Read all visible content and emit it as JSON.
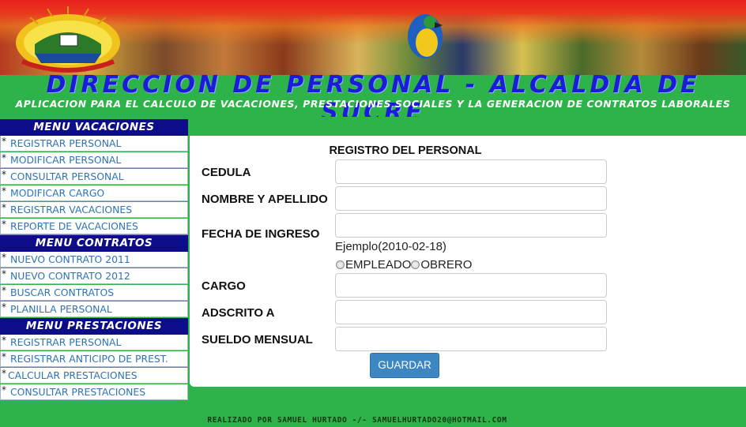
{
  "header": {
    "title": "DIRECCION DE PERSONAL - ALCALDIA DE SUCRE",
    "subtitle": "APLICACION PARA EL CALCULO DE VACACIONES, PRESTACIONES SOCIALES Y LA GENERACION DE CONTRATOS LABORALES"
  },
  "sidebar": {
    "menus": [
      {
        "heading": "MENU VACACIONES",
        "items": [
          {
            "label": "REGISTRAR PERSONAL"
          },
          {
            "label": "MODIFICAR PERSONAL"
          },
          {
            "label": "CONSULTAR PERSONAL"
          },
          {
            "label": "MODIFICAR CARGO"
          },
          {
            "label": "REGISTRAR VACACIONES"
          },
          {
            "label": "REPORTE DE VACACIONES"
          }
        ]
      },
      {
        "heading": "MENU CONTRATOS",
        "items": [
          {
            "label": "NUEVO CONTRATO 2011"
          },
          {
            "label": "NUEVO CONTRATO 2012"
          },
          {
            "label": "BUSCAR CONTRATOS"
          },
          {
            "label": "PLANILLA PERSONAL"
          }
        ]
      },
      {
        "heading": "MENU PRESTACIONES",
        "items": [
          {
            "label": "REGISTRAR PERSONAL"
          },
          {
            "label": "REGISTRAR ANTICIPO DE PREST."
          },
          {
            "label": "CALCULAR PRESTACIONES"
          },
          {
            "label": "CONSULTAR PRESTACIONES"
          }
        ]
      }
    ],
    "bullet": "*"
  },
  "form": {
    "title": "REGISTRO DEL PERSONAL",
    "fields": {
      "cedula": {
        "label": "CEDULA",
        "value": ""
      },
      "nombre": {
        "label": "NOMBRE Y APELLIDO",
        "value": ""
      },
      "fecha": {
        "label": "FECHA DE INGRESO",
        "value": "",
        "hint": "Ejemplo(2010-02-18)"
      },
      "cargo": {
        "label": "CARGO",
        "value": ""
      },
      "adscrito": {
        "label": "ADSCRITO A",
        "value": ""
      },
      "sueldo": {
        "label": "SUELDO MENSUAL",
        "value": ""
      }
    },
    "tipo": {
      "options": [
        "EMPLEADO",
        "OBRERO"
      ],
      "selected": null
    },
    "submit_label": "GUARDAR"
  },
  "footer": {
    "text": "REALIZADO POR SAMUEL HURTADO -/- SAMUELHURTADO20@HOTMAIL.COM"
  },
  "colors": {
    "page_background": "#2db34a",
    "menu_heading": "#0d0d8a",
    "menu_link": "#2f73b5",
    "title_blue": "#1c1cd8",
    "button": "#3d86c4"
  },
  "icons": {
    "seal": "municipal-seal-icon",
    "parrot": "macaw-artwork"
  }
}
